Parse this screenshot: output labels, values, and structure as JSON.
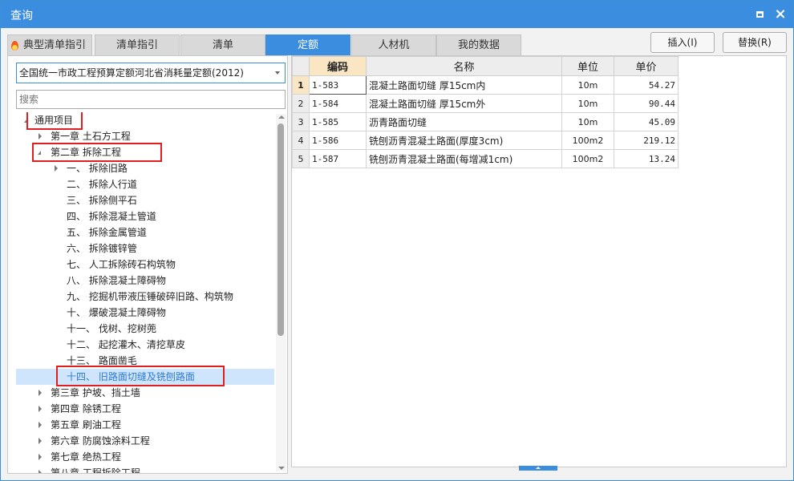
{
  "window": {
    "title": "查询"
  },
  "tabs": [
    {
      "label": "典型清单指引",
      "icon": "fire-icon"
    },
    {
      "label": "清单指引"
    },
    {
      "label": "清单"
    },
    {
      "label": "定额",
      "active": true
    },
    {
      "label": "人材机"
    },
    {
      "label": "我的数据"
    }
  ],
  "actions": {
    "insert": "插入(I)",
    "replace": "替换(R)"
  },
  "library": {
    "selected": "全国统一市政工程预算定额河北省消耗量定额(2012)"
  },
  "search": {
    "placeholder": "搜索"
  },
  "tree": [
    {
      "label": "通用项目",
      "expanded": true,
      "highlighted": true
    },
    {
      "label": "第一章 土石方工程"
    },
    {
      "label": "第二章 拆除工程",
      "expanded": true,
      "highlighted": true
    },
    {
      "label": "一、 拆除旧路"
    },
    {
      "label": "二、 拆除人行道"
    },
    {
      "label": "三、 拆除侧平石"
    },
    {
      "label": "四、 拆除混凝土管道"
    },
    {
      "label": "五、 拆除金属管道"
    },
    {
      "label": "六、 拆除镀锌管"
    },
    {
      "label": "七、 人工拆除砖石构筑物"
    },
    {
      "label": "八、 拆除混凝土障碍物"
    },
    {
      "label": "九、 挖掘机带液压锤破碎旧路、构筑物"
    },
    {
      "label": "十、 爆破混凝土障碍物"
    },
    {
      "label": "十一、 伐树、挖树蔸"
    },
    {
      "label": "十二、 起挖灌木、清挖草皮"
    },
    {
      "label": "十三、 路面凿毛"
    },
    {
      "label": "十四、 旧路面切缝及铣刨路面",
      "selected": true,
      "highlighted": true
    },
    {
      "label": "第三章 护坡、挡土墙"
    },
    {
      "label": "第四章 除锈工程"
    },
    {
      "label": "第五章 刷油工程"
    },
    {
      "label": "第六章 防腐蚀涂料工程"
    },
    {
      "label": "第七章 绝热工程"
    },
    {
      "label": "第八章 工程拆除工程"
    }
  ],
  "table": {
    "headers": {
      "code": "编码",
      "name": "名称",
      "unit": "单位",
      "price": "单价"
    },
    "rows": [
      {
        "index": "1",
        "code": "1-583",
        "name": "混凝土路面切缝 厚15cm内",
        "unit": "10m",
        "price": "54.27"
      },
      {
        "index": "2",
        "code": "1-584",
        "name": "混凝土路面切缝 厚15cm外",
        "unit": "10m",
        "price": "90.44"
      },
      {
        "index": "3",
        "code": "1-585",
        "name": "沥青路面切缝",
        "unit": "10m",
        "price": "45.09"
      },
      {
        "index": "4",
        "code": "1-586",
        "name": "铣刨沥青混凝土路面(厚度3cm)",
        "unit": "100m2",
        "price": "219.12"
      },
      {
        "index": "5",
        "code": "1-587",
        "name": "铣刨沥青混凝土路面(每增减1cm)",
        "unit": "100m2",
        "price": "13.24"
      }
    ]
  },
  "colors": {
    "accent": "#3b8de0",
    "highlight": "#e02020",
    "selected_bg": "#cfe5fb"
  }
}
